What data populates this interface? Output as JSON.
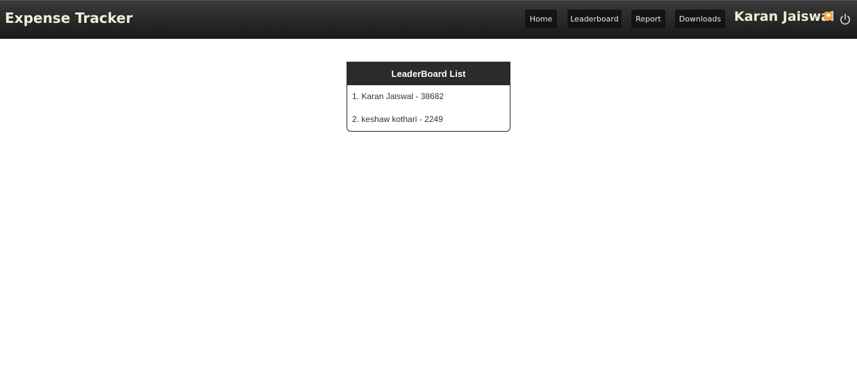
{
  "app": {
    "title": "Expense Tracker"
  },
  "nav": {
    "items": [
      {
        "label": "Home"
      },
      {
        "label": "Leaderboard"
      },
      {
        "label": "Report"
      },
      {
        "label": "Downloads"
      }
    ]
  },
  "user": {
    "name": "Karan Jaiswal",
    "premium_icon": "premium-badge-icon",
    "logout_icon": "power-icon"
  },
  "leaderboard": {
    "heading": "LeaderBoard List",
    "entries": [
      {
        "text": "1. Karan Jaiswal - 38682"
      },
      {
        "text": "2. keshaw kothari - 2249"
      }
    ]
  },
  "colors": {
    "header_bg": "#262626",
    "brand_text": "#f2edd6",
    "premium_badge": "#f3a73a"
  }
}
